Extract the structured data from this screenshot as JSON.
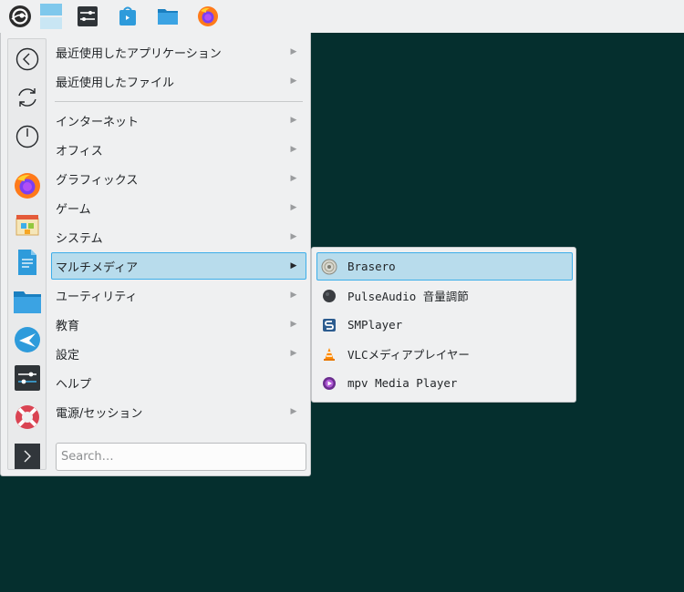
{
  "taskbar": {
    "items": [
      {
        "name": "application-launcher",
        "icon": "opensuse-icon"
      },
      {
        "name": "desktop-pager",
        "icon": "pager-icon"
      },
      {
        "name": "system-settings",
        "icon": "settings-icon"
      },
      {
        "name": "discover",
        "icon": "discover-icon"
      },
      {
        "name": "file-manager",
        "icon": "folder-icon"
      },
      {
        "name": "firefox",
        "icon": "firefox-icon"
      }
    ]
  },
  "favorites": [
    "back-icon",
    "restart-icon",
    "power-icon",
    "firefox-icon",
    "discover-icon",
    "text-editor-icon",
    "folder-icon",
    "kde-connect-icon",
    "system-settings-icon",
    "help-icon",
    "terminal-icon"
  ],
  "menu": {
    "items": [
      {
        "label": "最近使用したアプリケーション",
        "submenu": true
      },
      {
        "label": "最近使用したファイル",
        "submenu": true
      },
      {
        "label": "インターネット",
        "submenu": true
      },
      {
        "label": "オフィス",
        "submenu": true
      },
      {
        "label": "グラフィックス",
        "submenu": true
      },
      {
        "label": "ゲーム",
        "submenu": true
      },
      {
        "label": "システム",
        "submenu": true
      },
      {
        "label": "マルチメディア",
        "submenu": true,
        "highlighted": true
      },
      {
        "label": "ユーティリティ",
        "submenu": true
      },
      {
        "label": "教育",
        "submenu": true
      },
      {
        "label": "設定",
        "submenu": true
      },
      {
        "label": "ヘルプ",
        "submenu": false
      },
      {
        "label": "電源/セッション",
        "submenu": true
      }
    ],
    "arrow": "▶",
    "search_placeholder": "Search…"
  },
  "submenu": {
    "items": [
      {
        "label": "Brasero",
        "icon": "brasero-icon",
        "highlighted": true
      },
      {
        "label": "PulseAudio 音量調節",
        "icon": "pulseaudio-icon"
      },
      {
        "label": "SMPlayer",
        "icon": "smplayer-icon"
      },
      {
        "label": "VLCメディアプレイヤー",
        "icon": "vlc-icon"
      },
      {
        "label": "mpv Media Player",
        "icon": "mpv-icon"
      }
    ]
  },
  "colors": {
    "desktop": "#052f2e",
    "panel": "#eff0f1",
    "highlight": "#b8dcec",
    "highlight_border": "#3daee9"
  }
}
